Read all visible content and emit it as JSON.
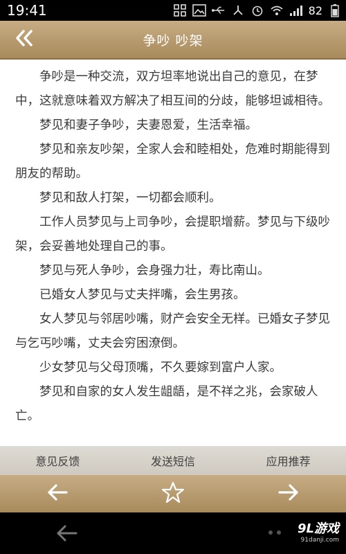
{
  "status_bar": {
    "time": "19:41",
    "battery_level": "82",
    "icons": [
      "grid-icon",
      "image-icon",
      "usb-icon",
      "network-icon",
      "alarm-icon",
      "wifi-icon",
      "signal-icon",
      "battery-icon"
    ]
  },
  "header": {
    "title": "争吵 吵架",
    "back_icon": "double-chevron-left-icon"
  },
  "article": {
    "paragraphs": [
      "争吵是一种交流，双方坦率地说出自己的意见，在梦中，这就意味着双方解决了相互间的分歧，能够坦诚相待。",
      "梦见和妻子争吵，夫妻恩爱，生活幸福。",
      "梦见和亲友吵架，全家人会和睦相处，危难时期能得到朋友的帮助。",
      "梦见和敌人打架，一切都会顺利。",
      "工作人员梦见与上司争吵，会提职增薪。梦见与下级吵架，会妥善地处理自己的事。",
      "梦见与死人争吵，会身强力壮，寿比南山。",
      "已婚女人梦见与丈夫拌嘴，会生男孩。",
      "女人梦见与邻居吵嘴，财产会安全无样。已婚女子梦见与乞丐吵嘴，丈夫会穷困潦倒。",
      "少女梦见与父母顶嘴，不久要嫁到富户人家。",
      "梦见和自家的女人发生龃龉，是不祥之兆，会家破人亡。"
    ]
  },
  "menu": {
    "feedback": "意见反馈",
    "send_sms": "发送短信",
    "app_recommend": "应用推荐"
  },
  "nav": {
    "prev_icon": "arrow-left-icon",
    "favorite_icon": "star-outline-icon",
    "next_icon": "arrow-right-icon"
  },
  "system": {
    "back_icon": "back-arrow-icon",
    "watermark_logo": "9L游戏",
    "watermark_url": "91danji.com"
  },
  "colors": {
    "bar_gold": "#b89b6e",
    "menu_gray": "#d6d2ca",
    "text": "#3a3a3a"
  }
}
